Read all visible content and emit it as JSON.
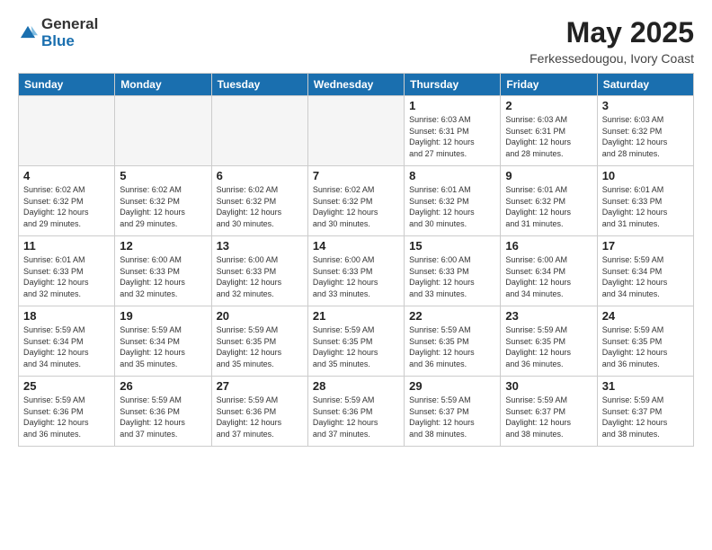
{
  "header": {
    "logo_general": "General",
    "logo_blue": "Blue",
    "title": "May 2025",
    "subtitle": "Ferkessedougou, Ivory Coast"
  },
  "days_of_week": [
    "Sunday",
    "Monday",
    "Tuesday",
    "Wednesday",
    "Thursday",
    "Friday",
    "Saturday"
  ],
  "weeks": [
    [
      {
        "day": "",
        "info": ""
      },
      {
        "day": "",
        "info": ""
      },
      {
        "day": "",
        "info": ""
      },
      {
        "day": "",
        "info": ""
      },
      {
        "day": "1",
        "info": "Sunrise: 6:03 AM\nSunset: 6:31 PM\nDaylight: 12 hours\nand 27 minutes."
      },
      {
        "day": "2",
        "info": "Sunrise: 6:03 AM\nSunset: 6:31 PM\nDaylight: 12 hours\nand 28 minutes."
      },
      {
        "day": "3",
        "info": "Sunrise: 6:03 AM\nSunset: 6:32 PM\nDaylight: 12 hours\nand 28 minutes."
      }
    ],
    [
      {
        "day": "4",
        "info": "Sunrise: 6:02 AM\nSunset: 6:32 PM\nDaylight: 12 hours\nand 29 minutes."
      },
      {
        "day": "5",
        "info": "Sunrise: 6:02 AM\nSunset: 6:32 PM\nDaylight: 12 hours\nand 29 minutes."
      },
      {
        "day": "6",
        "info": "Sunrise: 6:02 AM\nSunset: 6:32 PM\nDaylight: 12 hours\nand 30 minutes."
      },
      {
        "day": "7",
        "info": "Sunrise: 6:02 AM\nSunset: 6:32 PM\nDaylight: 12 hours\nand 30 minutes."
      },
      {
        "day": "8",
        "info": "Sunrise: 6:01 AM\nSunset: 6:32 PM\nDaylight: 12 hours\nand 30 minutes."
      },
      {
        "day": "9",
        "info": "Sunrise: 6:01 AM\nSunset: 6:32 PM\nDaylight: 12 hours\nand 31 minutes."
      },
      {
        "day": "10",
        "info": "Sunrise: 6:01 AM\nSunset: 6:33 PM\nDaylight: 12 hours\nand 31 minutes."
      }
    ],
    [
      {
        "day": "11",
        "info": "Sunrise: 6:01 AM\nSunset: 6:33 PM\nDaylight: 12 hours\nand 32 minutes."
      },
      {
        "day": "12",
        "info": "Sunrise: 6:00 AM\nSunset: 6:33 PM\nDaylight: 12 hours\nand 32 minutes."
      },
      {
        "day": "13",
        "info": "Sunrise: 6:00 AM\nSunset: 6:33 PM\nDaylight: 12 hours\nand 32 minutes."
      },
      {
        "day": "14",
        "info": "Sunrise: 6:00 AM\nSunset: 6:33 PM\nDaylight: 12 hours\nand 33 minutes."
      },
      {
        "day": "15",
        "info": "Sunrise: 6:00 AM\nSunset: 6:33 PM\nDaylight: 12 hours\nand 33 minutes."
      },
      {
        "day": "16",
        "info": "Sunrise: 6:00 AM\nSunset: 6:34 PM\nDaylight: 12 hours\nand 34 minutes."
      },
      {
        "day": "17",
        "info": "Sunrise: 5:59 AM\nSunset: 6:34 PM\nDaylight: 12 hours\nand 34 minutes."
      }
    ],
    [
      {
        "day": "18",
        "info": "Sunrise: 5:59 AM\nSunset: 6:34 PM\nDaylight: 12 hours\nand 34 minutes."
      },
      {
        "day": "19",
        "info": "Sunrise: 5:59 AM\nSunset: 6:34 PM\nDaylight: 12 hours\nand 35 minutes."
      },
      {
        "day": "20",
        "info": "Sunrise: 5:59 AM\nSunset: 6:35 PM\nDaylight: 12 hours\nand 35 minutes."
      },
      {
        "day": "21",
        "info": "Sunrise: 5:59 AM\nSunset: 6:35 PM\nDaylight: 12 hours\nand 35 minutes."
      },
      {
        "day": "22",
        "info": "Sunrise: 5:59 AM\nSunset: 6:35 PM\nDaylight: 12 hours\nand 36 minutes."
      },
      {
        "day": "23",
        "info": "Sunrise: 5:59 AM\nSunset: 6:35 PM\nDaylight: 12 hours\nand 36 minutes."
      },
      {
        "day": "24",
        "info": "Sunrise: 5:59 AM\nSunset: 6:35 PM\nDaylight: 12 hours\nand 36 minutes."
      }
    ],
    [
      {
        "day": "25",
        "info": "Sunrise: 5:59 AM\nSunset: 6:36 PM\nDaylight: 12 hours\nand 36 minutes."
      },
      {
        "day": "26",
        "info": "Sunrise: 5:59 AM\nSunset: 6:36 PM\nDaylight: 12 hours\nand 37 minutes."
      },
      {
        "day": "27",
        "info": "Sunrise: 5:59 AM\nSunset: 6:36 PM\nDaylight: 12 hours\nand 37 minutes."
      },
      {
        "day": "28",
        "info": "Sunrise: 5:59 AM\nSunset: 6:36 PM\nDaylight: 12 hours\nand 37 minutes."
      },
      {
        "day": "29",
        "info": "Sunrise: 5:59 AM\nSunset: 6:37 PM\nDaylight: 12 hours\nand 38 minutes."
      },
      {
        "day": "30",
        "info": "Sunrise: 5:59 AM\nSunset: 6:37 PM\nDaylight: 12 hours\nand 38 minutes."
      },
      {
        "day": "31",
        "info": "Sunrise: 5:59 AM\nSunset: 6:37 PM\nDaylight: 12 hours\nand 38 minutes."
      }
    ]
  ]
}
